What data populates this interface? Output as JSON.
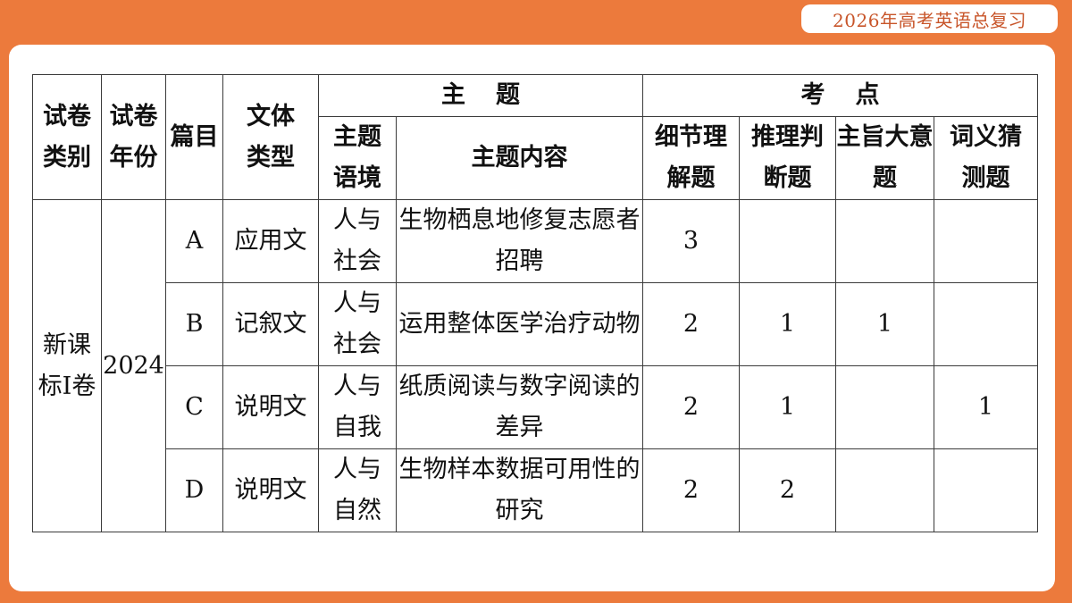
{
  "badge": {
    "text": "2026年高考英语总复习"
  },
  "table": {
    "headers": {
      "paper_category": "试卷类别",
      "paper_year": "试卷年份",
      "passage": "篇目",
      "text_type": "文体类型",
      "theme": "主题",
      "theme_context": "主题语境",
      "theme_content": "主题内容",
      "test_points": "考点",
      "detail": "细节理解题",
      "inference": "推理判断题",
      "main_idea": "主旨大意题",
      "word_meaning": "词义猜测题"
    },
    "paper": "新课标Ⅰ卷",
    "year": "2024",
    "rows": [
      {
        "passage": "A",
        "text_type": "应用文",
        "context": "人与社会",
        "content": "生物栖息地修复志愿者招聘",
        "detail": "3",
        "inference": "",
        "main_idea": "",
        "word_meaning": ""
      },
      {
        "passage": "B",
        "text_type": "记叙文",
        "context": "人与社会",
        "content": "运用整体医学治疗动物",
        "detail": "2",
        "inference": "1",
        "main_idea": "1",
        "word_meaning": ""
      },
      {
        "passage": "C",
        "text_type": "说明文",
        "context": "人与自我",
        "content": "纸质阅读与数字阅读的差异",
        "detail": "2",
        "inference": "1",
        "main_idea": "",
        "word_meaning": "1"
      },
      {
        "passage": "D",
        "text_type": "说明文",
        "context": "人与自然",
        "content": "生物样本数据可用性的研究",
        "detail": "2",
        "inference": "2",
        "main_idea": "",
        "word_meaning": ""
      }
    ]
  },
  "colors": {
    "accent": "#ec7a3c",
    "badge_text": "#c8552a",
    "panel": "#ffffff"
  }
}
